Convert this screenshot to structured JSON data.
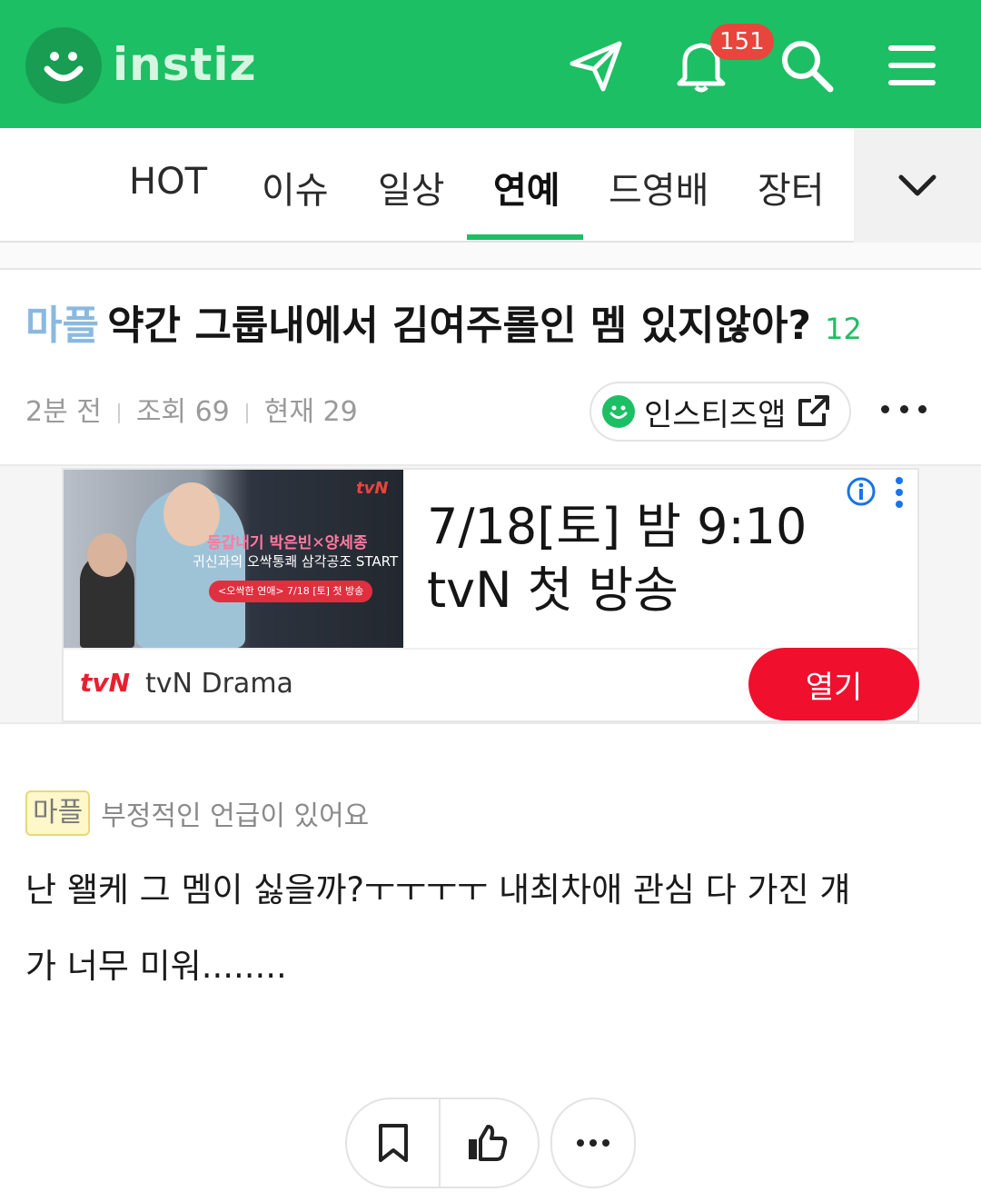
{
  "header": {
    "logo_text": "instiz",
    "notification_count": "151",
    "brand_color": "#1cbf63",
    "badge_color": "#e8453c",
    "icons": [
      "send-icon",
      "bell-icon",
      "search-icon",
      "menu-icon"
    ]
  },
  "tabs": {
    "items": [
      {
        "label": "HOT"
      },
      {
        "label": "이슈"
      },
      {
        "label": "일상"
      },
      {
        "label": "연예"
      },
      {
        "label": "드영배"
      },
      {
        "label": "장터"
      }
    ],
    "active": "연예",
    "more_icon": "chevron-down-icon"
  },
  "post": {
    "category": "마플",
    "title": "약간 그룹내에서 김여주롤인 멤 있지않아?",
    "comment_count": "12",
    "time": "2분 전",
    "views": "조회 69",
    "current": "현재 29",
    "app_button_label": "인스티즈앱",
    "warning_tag": "마플",
    "warning_text": "부정적인 언급이 있어요",
    "body_line1": "난 왤케 그 멤이 싫을까?ㅜㅜㅜㅜ 내최차애 관심 다 가진 걔",
    "body_line2": "가 너무 미워........"
  },
  "ad": {
    "image_brand": "tvN",
    "image_line1": "동갑내기 박은빈✕양세종",
    "image_line2": "귀신과의 오싹통쾌 삼각공조 START",
    "image_pill": "<오싹한 연애> 7/18 [토] 첫 방송",
    "headline_line1": "7/18[토] 밤 9:10",
    "headline_line2": "tvN 첫 방송",
    "brand_logo": "tvN",
    "brand_name": "tvN Drama",
    "open_button": "열기",
    "accent_color": "#f0102e"
  },
  "actions": {
    "icons": [
      "bookmark-icon",
      "thumbs-up-icon",
      "more-icon"
    ]
  }
}
